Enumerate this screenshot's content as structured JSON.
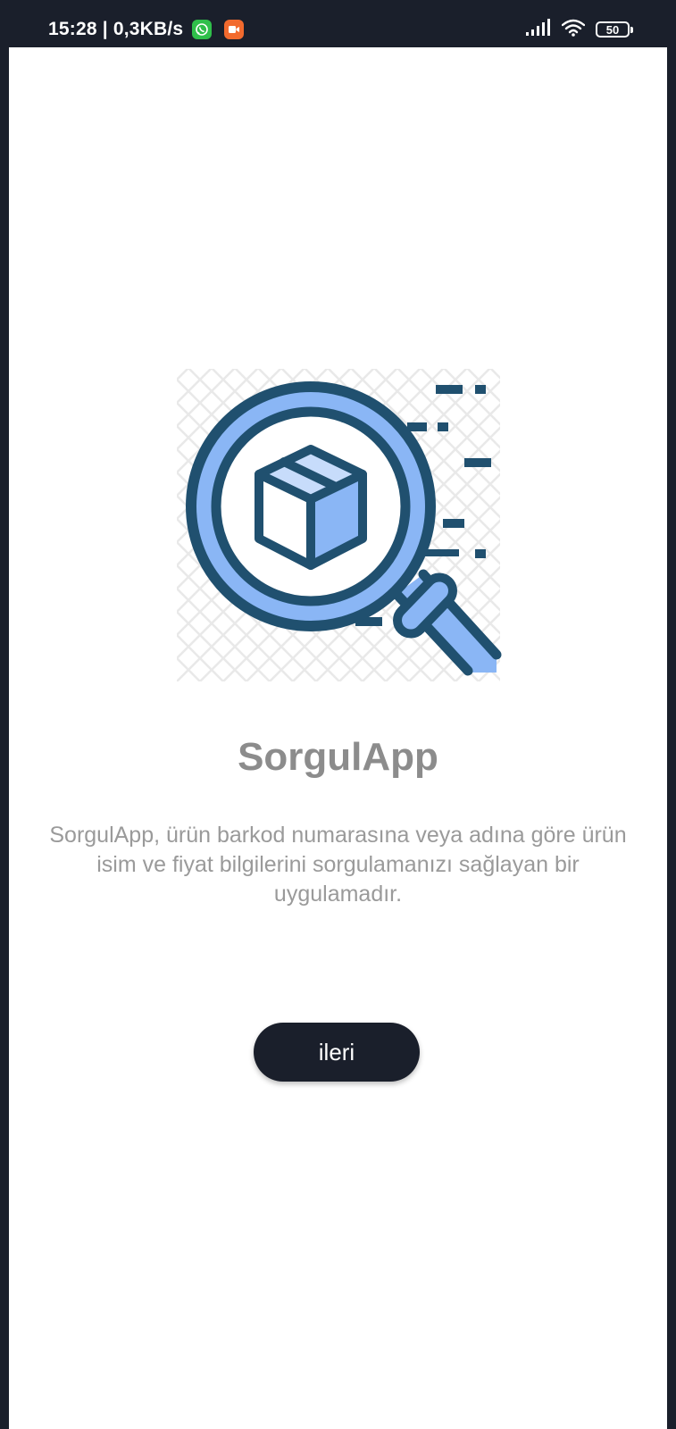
{
  "status_bar": {
    "time_speed": "15:28 | 0,3KB/s",
    "battery_level": "50",
    "icons": [
      "whatsapp-icon",
      "screen-recorder-icon",
      "signal-icon",
      "wifi-icon",
      "battery-icon"
    ]
  },
  "onboarding": {
    "title": "SorgulApp",
    "description": "SorgulApp, ürün barkod numarasına veya adına göre ürün isim ve fiyat bilgilerini sorgulamanızı sağlayan bir uygulamadır.",
    "next_button_label": "ileri",
    "illustration_icon": "magnifier-package-icon"
  },
  "colors": {
    "dark": "#1a1f2b",
    "accent_blue": "#8ab6f5",
    "light_blue": "#c7dcfb",
    "outline": "#20506f",
    "title_gray": "#8c8c8c",
    "text_gray": "#9a9a9a"
  }
}
